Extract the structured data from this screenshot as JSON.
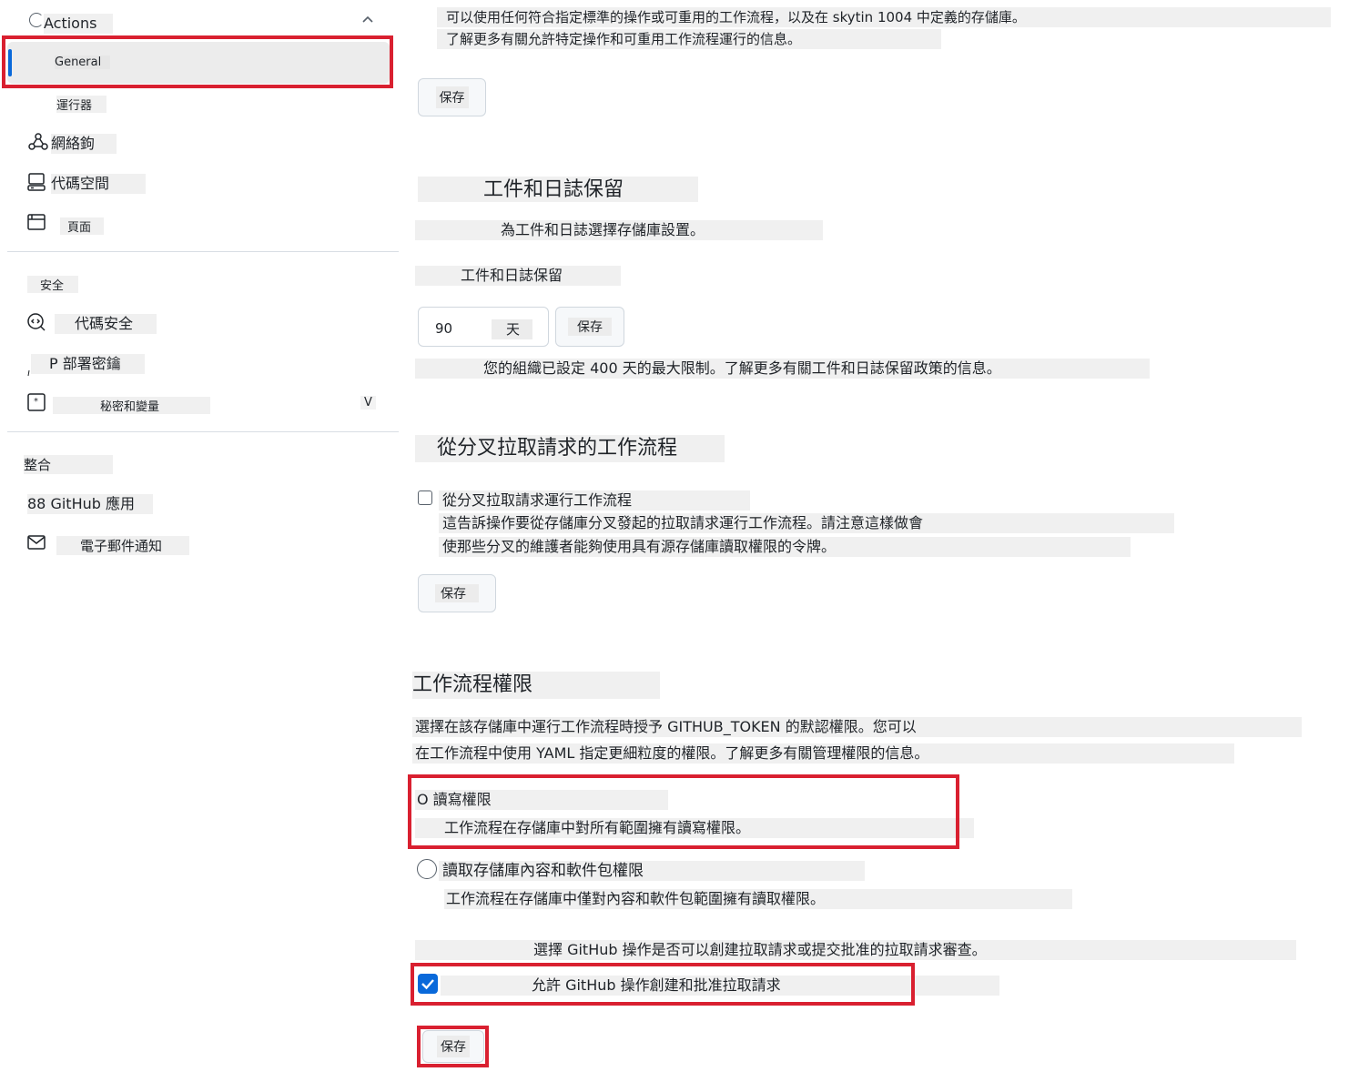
{
  "sidebar": {
    "actions_label": "Actions",
    "actions_chevron": "^",
    "items": [
      {
        "label": "General"
      },
      {
        "label": "運行器"
      },
      {
        "label": "網絡鉤"
      },
      {
        "label": "代碼空間"
      },
      {
        "label": "頁面"
      }
    ],
    "security_heading": "安全",
    "security_items": [
      {
        "label": "代碼安全"
      },
      {
        "label": "P 部署密鑰"
      },
      {
        "label": "秘密和變量",
        "chevron": "V"
      }
    ],
    "integrations_heading": "整合",
    "integration_items": [
      {
        "label": "88 GitHub 應用"
      },
      {
        "label": "電子郵件通知"
      }
    ]
  },
  "main": {
    "intro_line1": "可以使用任何符合指定標準的操作或可重用的工作流程，以及在 skytin 1004 中定義的存儲庫。",
    "intro_line2": "了解更多有關允許特定操作和可重用工作流程運行的信息。",
    "save_label": "保存",
    "artifact": {
      "title": "工件和日誌保留",
      "description": "為工件和日誌選擇存儲庫設置。",
      "field_label": "工件和日誌保留",
      "value": "90",
      "unit": "天",
      "save_label": "保存",
      "note": "您的組織已設定 400 天的最大限制。了解更多有關工件和日誌保留政策的信息。"
    },
    "fork": {
      "title": "從分叉拉取請求的工作流程",
      "checkbox_label": "從分叉拉取請求運行工作流程",
      "checked": false,
      "desc_line1": "這告訴操作要從存儲庫分叉發起的拉取請求運行工作流程。請注意這樣做會",
      "desc_line2": "使那些分叉的維護者能夠使用具有源存儲庫讀取權限的令牌。",
      "save_label": "保存"
    },
    "permissions": {
      "title": "工作流程權限",
      "desc_line1": "選擇在該存儲庫中運行工作流程時授予 GITHUB_TOKEN 的默認權限。您可以",
      "desc_line2": "在工作流程中使用 YAML 指定更細粒度的權限。了解更多有關管理權限的信息。",
      "option_rw_label": "O 讀寫權限",
      "option_rw_desc": "工作流程在存儲庫中對所有範圍擁有讀寫權限。",
      "option_ro_label": "讀取存儲庫內容和軟件包權限",
      "option_ro_desc": "工作流程在存儲庫中僅對內容和軟件包範圍擁有讀取權限。",
      "pr_question": "選擇 GitHub 操作是否可以創建拉取請求或提交批准的拉取請求審查。",
      "pr_checkbox_label": "允許 GitHub 操作創建和批准拉取請求",
      "pr_checked": true,
      "save_label": "保存"
    }
  },
  "colors": {
    "highlight_red": "#d92030",
    "checkbox_blue": "#0969da",
    "active_bar": "#0969da"
  }
}
